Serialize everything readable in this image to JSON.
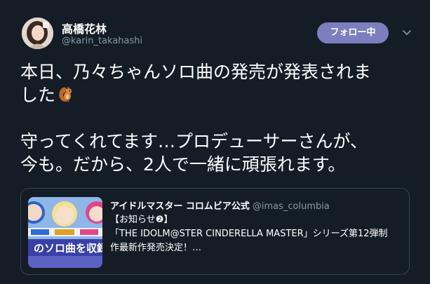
{
  "user": {
    "display_name": "高橋花林",
    "handle": "@karin_takahashi"
  },
  "follow_button": {
    "label": "フォロー中"
  },
  "tweet": {
    "line1": "本日、乃々ちゃんソロ曲の発売が発表されま",
    "line2": "した",
    "line3": "守ってくれてます…プロデューサーさんが、",
    "line4": "今も。だから、2人で一緒に頑張れます。"
  },
  "quote": {
    "name": "アイドルマスター コロムビア公式",
    "handle": "@imas_columbia",
    "line1": "【お知らせ❷】",
    "line2": "「THE IDOLM@STER CINDERELLA MASTER」シリーズ第12弾制",
    "line3": "作最新作発売決定！…",
    "thumb_text": "のソロ曲を収録"
  },
  "icons": {
    "emoji": "chipmunk-emoji",
    "menu": "chevron-down-icon"
  },
  "colors": {
    "background": "#141d26",
    "follow_button": "#7b7fbe",
    "secondary_text": "#8899a6",
    "border": "#38444d"
  }
}
